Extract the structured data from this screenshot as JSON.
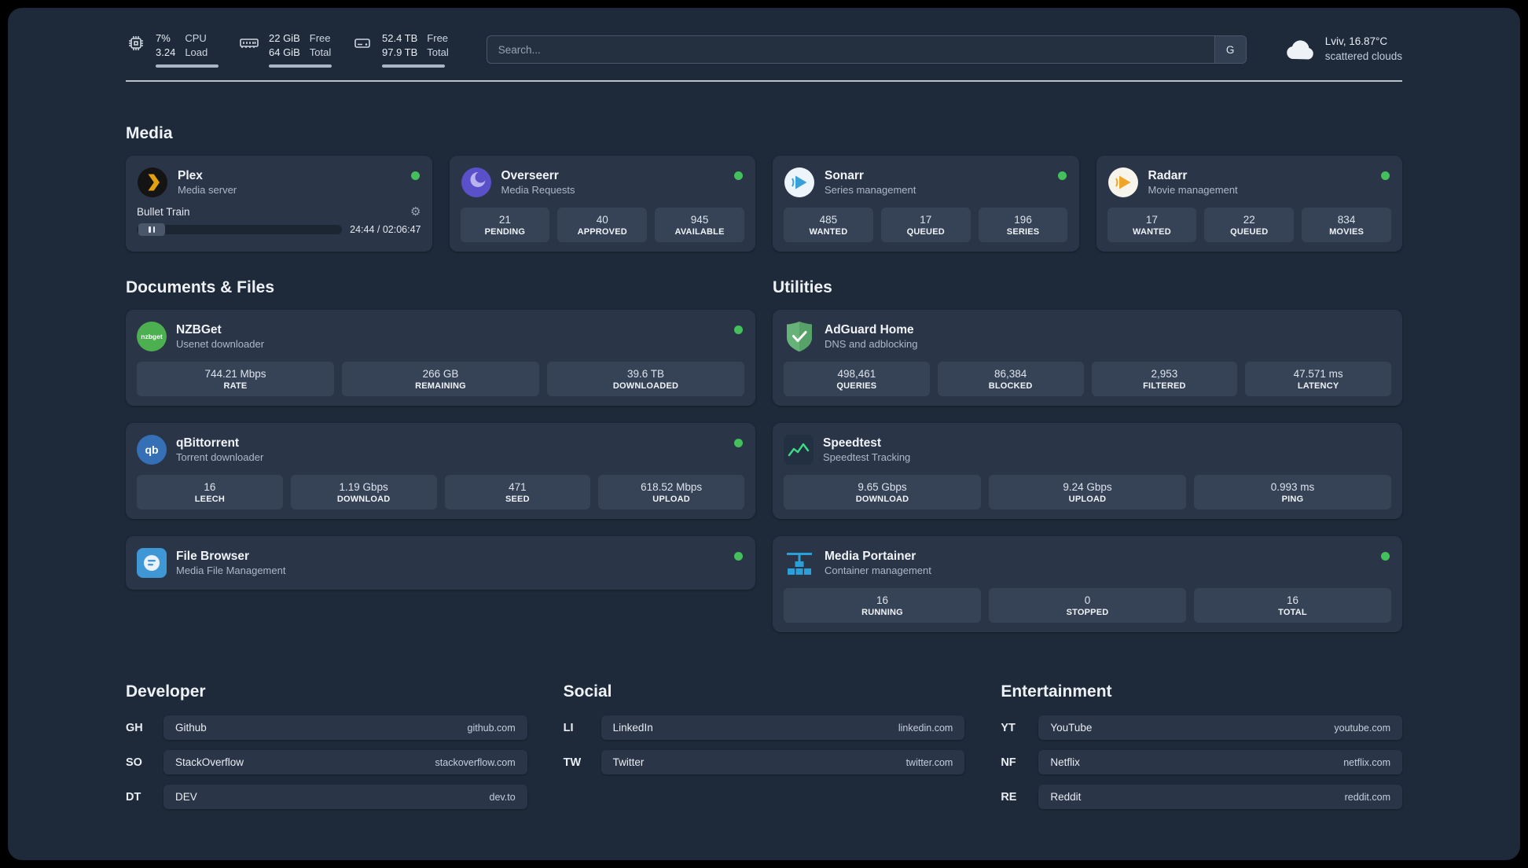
{
  "colors": {
    "bg": "#1e2a3a",
    "card": "#2a3547",
    "tile": "#364357",
    "status_online": "#43c05c"
  },
  "topbar": {
    "cpu": {
      "value_top": "7%",
      "value_bottom": "3.24",
      "label_top": "CPU",
      "label_bottom": "Load"
    },
    "ram": {
      "value_top": "22 GiB",
      "value_bottom": "64 GiB",
      "label_top": "Free",
      "label_bottom": "Total"
    },
    "disk": {
      "value_top": "52.4 TB",
      "value_bottom": "97.9 TB",
      "label_top": "Free",
      "label_bottom": "Total"
    },
    "search": {
      "placeholder": "Search...",
      "engine_label": "G"
    },
    "weather": {
      "location": "Lviv, 16.87°C",
      "condition": "scattered clouds"
    }
  },
  "sections": {
    "media": {
      "title": "Media",
      "apps": [
        {
          "name": "Plex",
          "subtitle": "Media server",
          "player": {
            "track": "Bullet Train",
            "time": "24:44 / 02:06:47"
          }
        },
        {
          "name": "Overseerr",
          "subtitle": "Media Requests",
          "stats": [
            {
              "value": "21",
              "label": "PENDING"
            },
            {
              "value": "40",
              "label": "APPROVED"
            },
            {
              "value": "945",
              "label": "AVAILABLE"
            }
          ]
        },
        {
          "name": "Sonarr",
          "subtitle": "Series management",
          "stats": [
            {
              "value": "485",
              "label": "WANTED"
            },
            {
              "value": "17",
              "label": "QUEUED"
            },
            {
              "value": "196",
              "label": "SERIES"
            }
          ]
        },
        {
          "name": "Radarr",
          "subtitle": "Movie management",
          "stats": [
            {
              "value": "17",
              "label": "WANTED"
            },
            {
              "value": "22",
              "label": "QUEUED"
            },
            {
              "value": "834",
              "label": "MOVIES"
            }
          ]
        }
      ]
    },
    "documents": {
      "title": "Documents & Files",
      "apps": [
        {
          "name": "NZBGet",
          "subtitle": "Usenet downloader",
          "icon_text": "nzbget",
          "stats": [
            {
              "value": "744.21 Mbps",
              "label": "RATE"
            },
            {
              "value": "266 GB",
              "label": "REMAINING"
            },
            {
              "value": "39.6 TB",
              "label": "DOWNLOADED"
            }
          ]
        },
        {
          "name": "qBittorrent",
          "subtitle": "Torrent downloader",
          "icon_text": "qb",
          "stats": [
            {
              "value": "16",
              "label": "LEECH"
            },
            {
              "value": "1.19 Gbps",
              "label": "DOWNLOAD"
            },
            {
              "value": "471",
              "label": "SEED"
            },
            {
              "value": "618.52 Mbps",
              "label": "UPLOAD"
            }
          ]
        },
        {
          "name": "File Browser",
          "subtitle": "Media File Management",
          "stats": []
        }
      ]
    },
    "utilities": {
      "title": "Utilities",
      "apps": [
        {
          "name": "AdGuard Home",
          "subtitle": "DNS and adblocking",
          "stats": [
            {
              "value": "498,461",
              "label": "QUERIES"
            },
            {
              "value": "86,384",
              "label": "BLOCKED"
            },
            {
              "value": "2,953",
              "label": "FILTERED"
            },
            {
              "value": "47.571 ms",
              "label": "LATENCY"
            }
          ]
        },
        {
          "name": "Speedtest",
          "subtitle": "Speedtest Tracking",
          "stats": [
            {
              "value": "9.65 Gbps",
              "label": "DOWNLOAD"
            },
            {
              "value": "9.24 Gbps",
              "label": "UPLOAD"
            },
            {
              "value": "0.993 ms",
              "label": "PING"
            }
          ]
        },
        {
          "name": "Media Portainer",
          "subtitle": "Container management",
          "stats": [
            {
              "value": "16",
              "label": "RUNNING"
            },
            {
              "value": "0",
              "label": "STOPPED"
            },
            {
              "value": "16",
              "label": "TOTAL"
            }
          ]
        }
      ]
    },
    "bookmarks": [
      {
        "title": "Developer",
        "items": [
          {
            "abbr": "GH",
            "name": "Github",
            "url": "github.com"
          },
          {
            "abbr": "SO",
            "name": "StackOverflow",
            "url": "stackoverflow.com"
          },
          {
            "abbr": "DT",
            "name": "DEV",
            "url": "dev.to"
          }
        ]
      },
      {
        "title": "Social",
        "items": [
          {
            "abbr": "LI",
            "name": "LinkedIn",
            "url": "linkedin.com"
          },
          {
            "abbr": "TW",
            "name": "Twitter",
            "url": "twitter.com"
          }
        ]
      },
      {
        "title": "Entertainment",
        "items": [
          {
            "abbr": "YT",
            "name": "YouTube",
            "url": "youtube.com"
          },
          {
            "abbr": "NF",
            "name": "Netflix",
            "url": "netflix.com"
          },
          {
            "abbr": "RE",
            "name": "Reddit",
            "url": "reddit.com"
          }
        ]
      }
    ]
  }
}
